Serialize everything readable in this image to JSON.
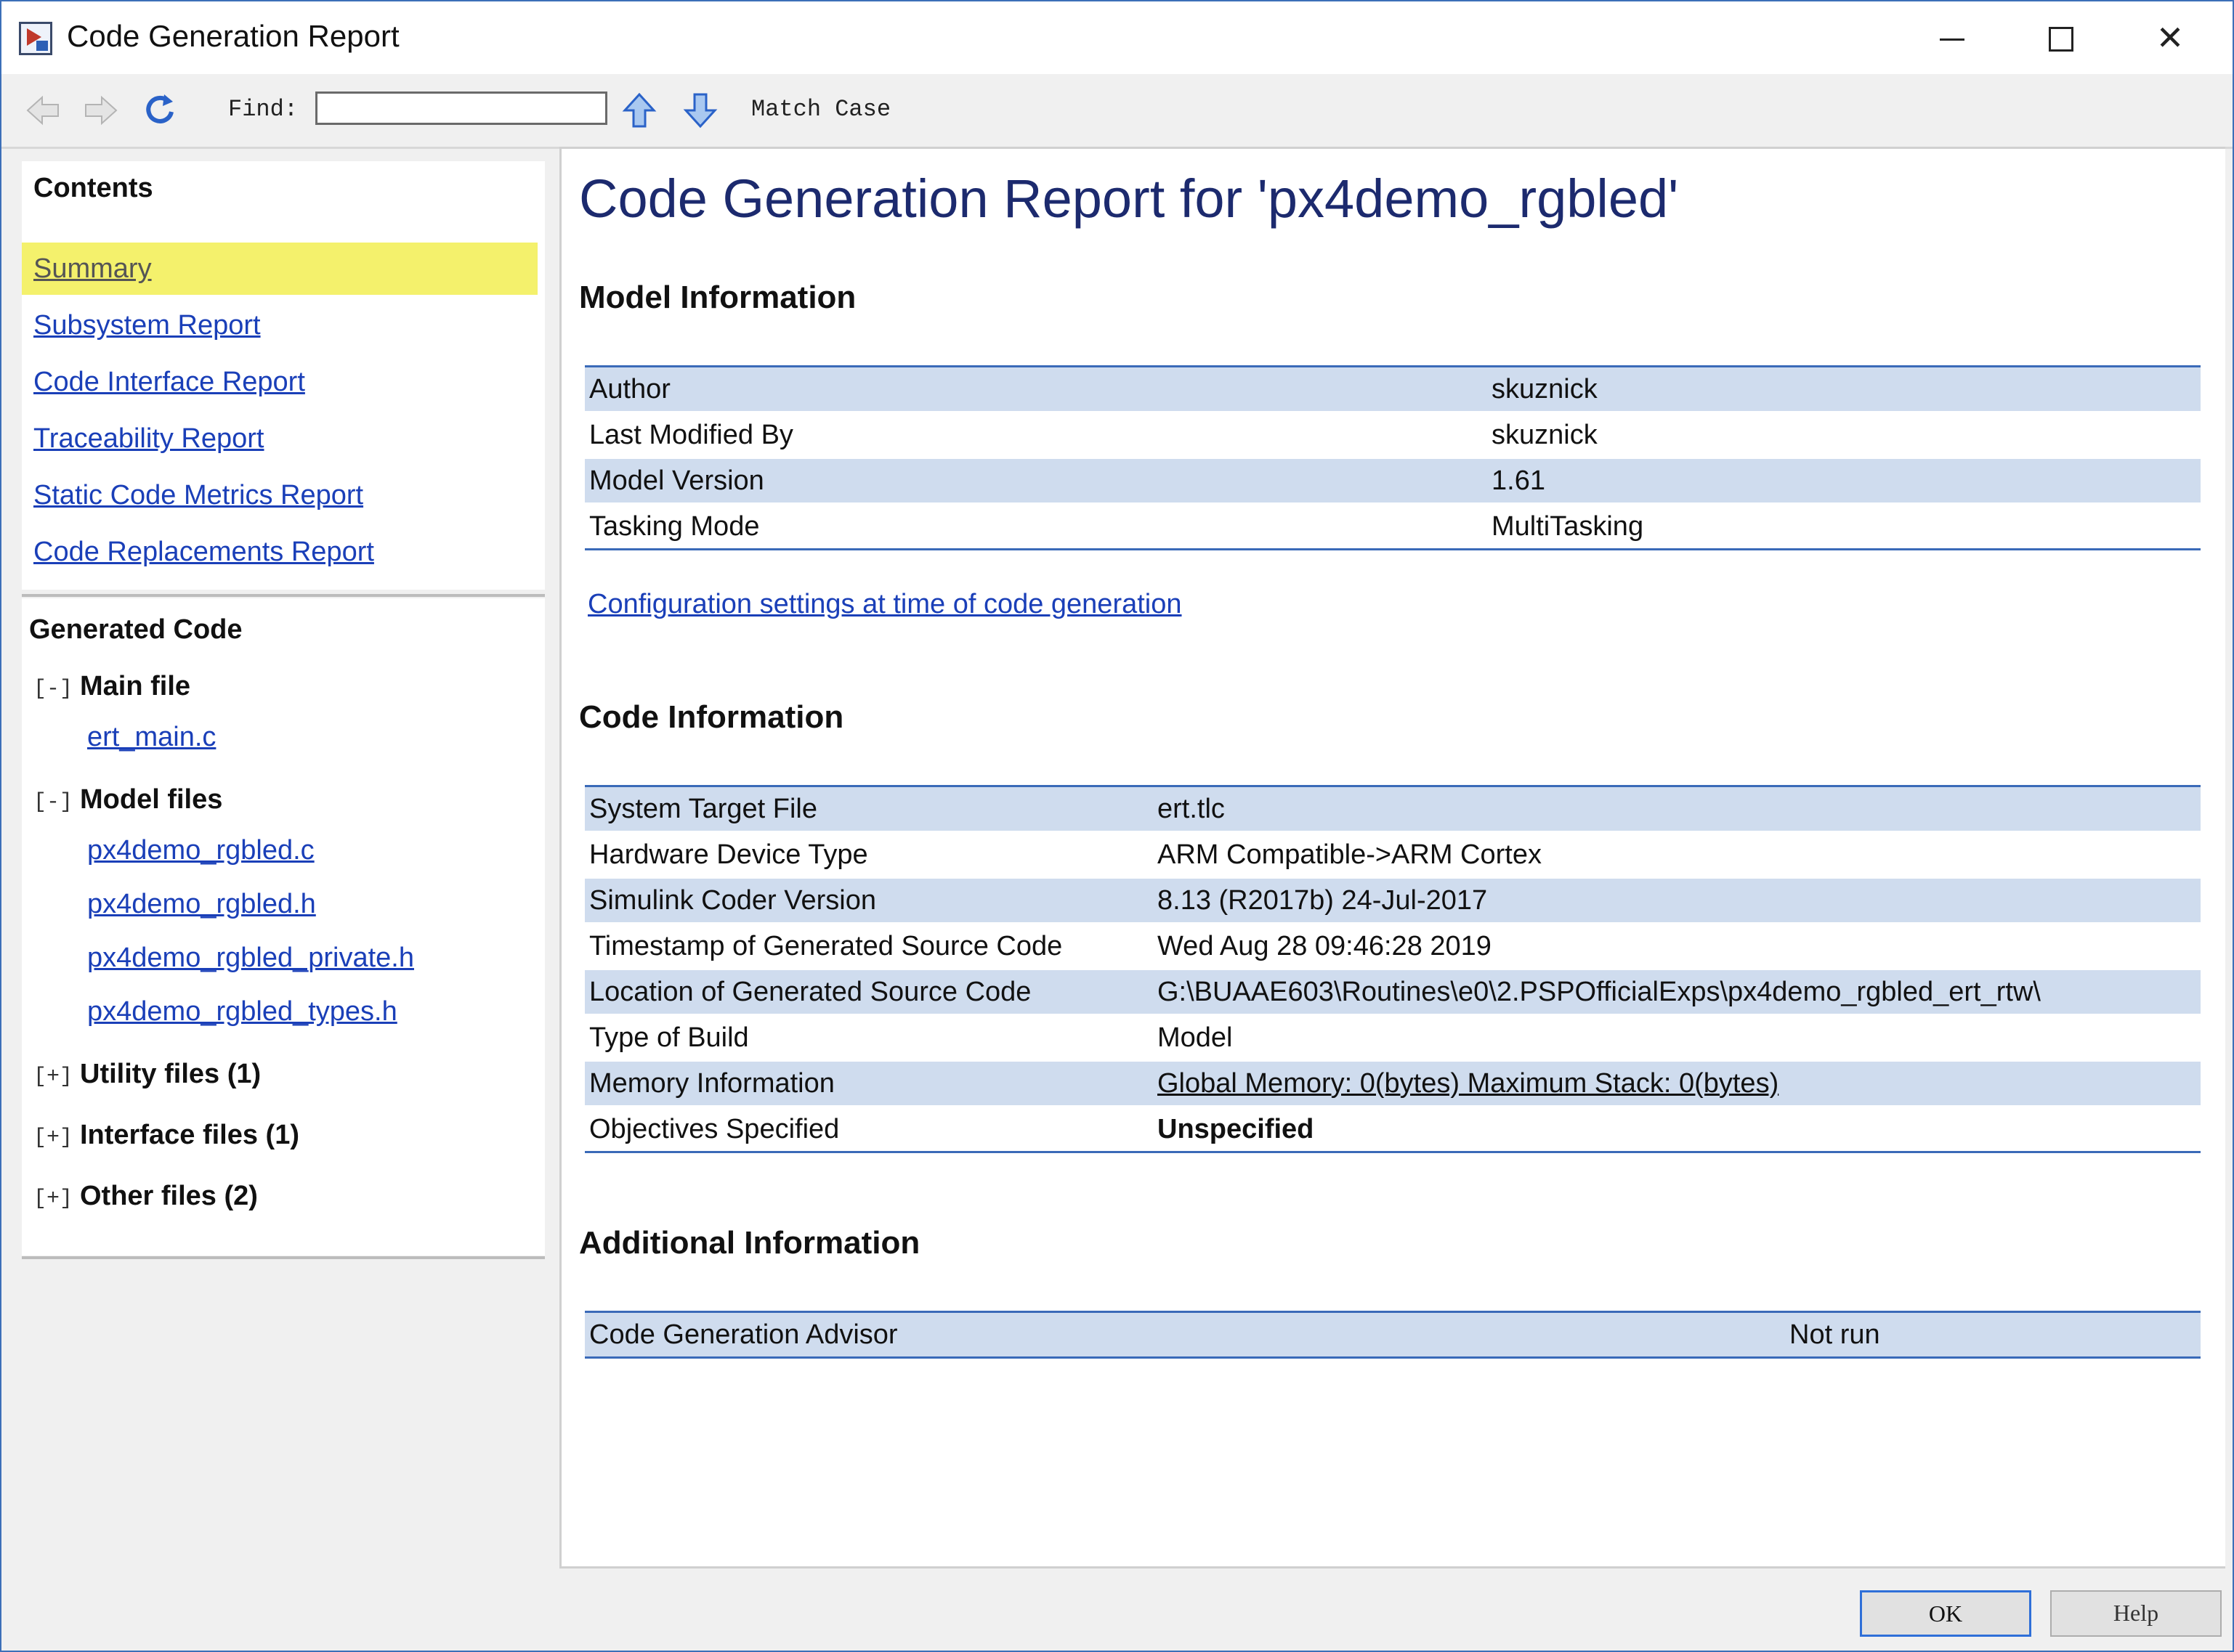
{
  "window": {
    "title": "Code Generation Report"
  },
  "toolbar": {
    "find_label": "Find:",
    "find_value": "",
    "match_case_label": "Match Case",
    "icons": [
      "back-arrow-icon",
      "forward-arrow-icon",
      "refresh-icon",
      "find-previous-arrow-icon",
      "find-next-arrow-icon"
    ]
  },
  "contents": {
    "heading": "Contents",
    "items": [
      {
        "label": "Summary",
        "active": true
      },
      {
        "label": "Subsystem Report"
      },
      {
        "label": "Code Interface Report"
      },
      {
        "label": "Traceability Report"
      },
      {
        "label": "Static Code Metrics Report"
      },
      {
        "label": "Code Replacements Report"
      }
    ]
  },
  "generated_code": {
    "heading": "Generated Code",
    "main_file": {
      "toggle": "[-]",
      "label": "Main file",
      "files": [
        "ert_main.c"
      ]
    },
    "model_files": {
      "toggle": "[-]",
      "label": "Model files",
      "files": [
        "px4demo_rgbled.c",
        "px4demo_rgbled.h",
        "px4demo_rgbled_private.h",
        "px4demo_rgbled_types.h"
      ]
    },
    "utility_files": {
      "toggle": "[+]",
      "label": "Utility files (1)"
    },
    "interface_files": {
      "toggle": "[+]",
      "label": "Interface files (1)"
    },
    "other_files": {
      "toggle": "[+]",
      "label": "Other files (2)"
    }
  },
  "report": {
    "title": "Code Generation Report for 'px4demo_rgbled'",
    "model_info": {
      "heading": "Model Information",
      "rows": [
        {
          "label": "Author",
          "value": "skuznick"
        },
        {
          "label": "Last Modified By",
          "value": "skuznick"
        },
        {
          "label": "Model Version",
          "value": "1.61"
        },
        {
          "label": "Tasking Mode",
          "value": "MultiTasking"
        }
      ]
    },
    "config_link": "Configuration settings at time of code generation",
    "code_info": {
      "heading": "Code Information",
      "rows": [
        {
          "label": "System Target File",
          "value": "ert.tlc"
        },
        {
          "label": "Hardware Device Type",
          "value": "ARM Compatible->ARM Cortex"
        },
        {
          "label": "Simulink Coder Version",
          "value": "8.13 (R2017b) 24-Jul-2017"
        },
        {
          "label": "Timestamp of Generated Source Code",
          "value": "Wed Aug 28 09:46:28 2019"
        },
        {
          "label": "Location of Generated Source Code",
          "value": "G:\\BUAAE603\\Routines\\e0\\2.PSPOfficialExps\\px4demo_rgbled_ert_rtw\\"
        },
        {
          "label": "Type of Build",
          "value": "Model"
        },
        {
          "label": "Memory Information",
          "value": "Global Memory: 0(bytes) Maximum Stack: 0(bytes)"
        },
        {
          "label": "Objectives Specified",
          "value": "Unspecified"
        }
      ]
    },
    "additional_info": {
      "heading": "Additional Information",
      "rows": [
        {
          "label": "Code Generation Advisor",
          "value": "Not run"
        }
      ]
    }
  },
  "buttons": {
    "ok": "OK",
    "help": "Help"
  },
  "colors": {
    "title_text": "#1c2a6e",
    "link": "#1a3fb8",
    "active_nav_bg": "#f4f16c",
    "row_stripe": "#cfdcee",
    "table_rule": "#3a6ab8",
    "warning": "#e99a0f"
  }
}
